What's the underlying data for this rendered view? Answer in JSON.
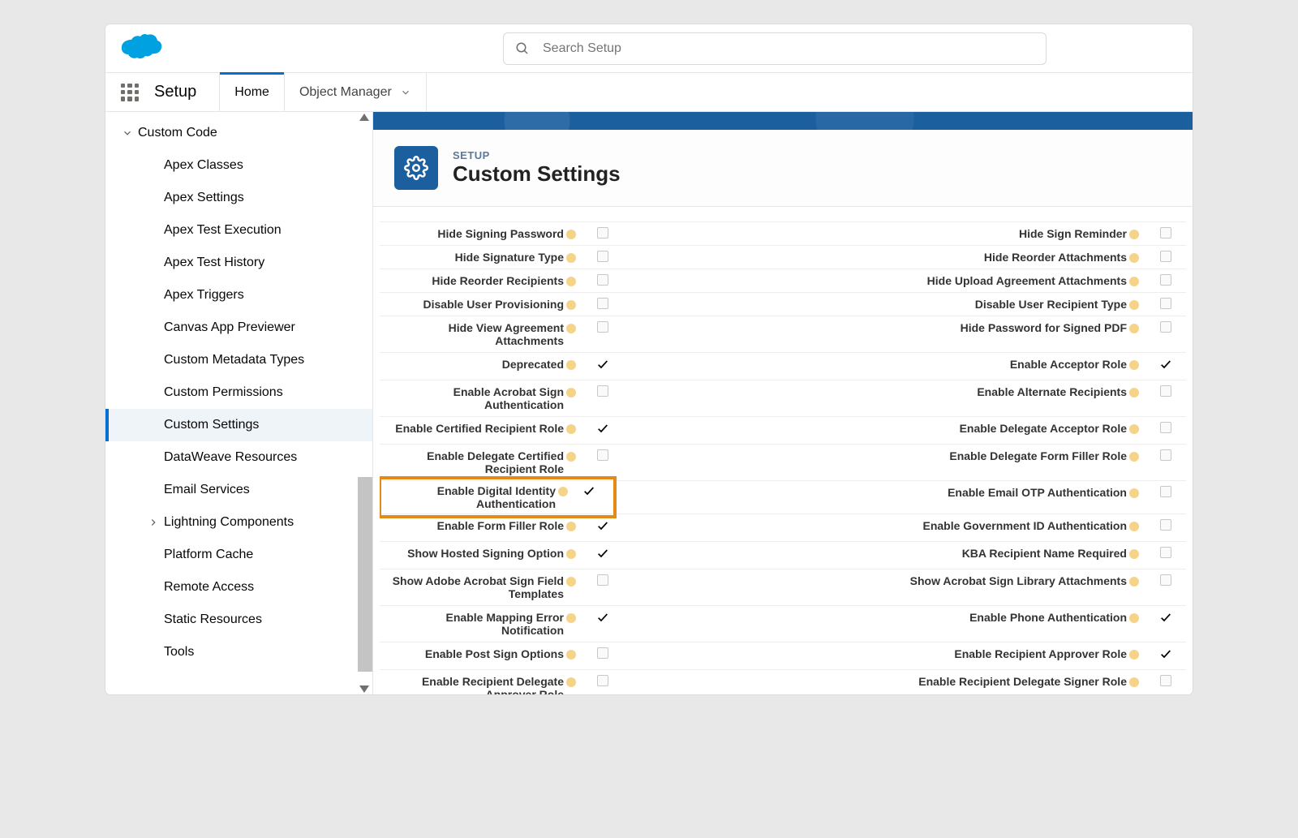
{
  "header": {
    "search_placeholder": "Search Setup"
  },
  "nav": {
    "brand": "Setup",
    "tabs": [
      {
        "label": "Home",
        "active": true
      },
      {
        "label": "Object Manager",
        "active": false,
        "dropdown": true
      }
    ]
  },
  "sidebar": {
    "root": "Custom Code",
    "items": [
      {
        "label": "Apex Classes"
      },
      {
        "label": "Apex Settings"
      },
      {
        "label": "Apex Test Execution"
      },
      {
        "label": "Apex Test History"
      },
      {
        "label": "Apex Triggers"
      },
      {
        "label": "Canvas App Previewer"
      },
      {
        "label": "Custom Metadata Types"
      },
      {
        "label": "Custom Permissions"
      },
      {
        "label": "Custom Settings",
        "selected": true
      },
      {
        "label": "DataWeave Resources"
      },
      {
        "label": "Email Services"
      },
      {
        "label": "Lightning Components",
        "expandable": true
      },
      {
        "label": "Platform Cache"
      },
      {
        "label": "Remote Access"
      },
      {
        "label": "Static Resources"
      },
      {
        "label": "Tools"
      }
    ]
  },
  "page": {
    "eyebrow": "SETUP",
    "title": "Custom Settings"
  },
  "settings_rows": [
    {
      "left_label": "Hide Signing Password",
      "left_checked": false,
      "right_label": "Hide Sign Reminder",
      "right_checked": false
    },
    {
      "left_label": "Hide Signature Type",
      "left_checked": false,
      "right_label": "Hide Reorder Attachments",
      "right_checked": false
    },
    {
      "left_label": "Hide Reorder Recipients",
      "left_checked": false,
      "right_label": "Hide Upload Agreement Attachments",
      "right_checked": false
    },
    {
      "left_label": "Disable User Provisioning",
      "left_checked": false,
      "right_label": "Disable User Recipient Type",
      "right_checked": false
    },
    {
      "left_label": "Hide View Agreement Attachments",
      "left_checked": false,
      "right_label": "Hide Password for Signed PDF",
      "right_checked": false
    },
    {
      "left_label": "Deprecated",
      "left_checked": true,
      "right_label": "Enable Acceptor Role",
      "right_checked": true
    },
    {
      "left_label": "Enable Acrobat Sign Authentication",
      "left_checked": false,
      "right_label": "Enable Alternate Recipients",
      "right_checked": false
    },
    {
      "left_label": "Enable Certified Recipient Role",
      "left_checked": true,
      "right_label": "Enable Delegate Acceptor Role",
      "right_checked": false
    },
    {
      "left_label": "Enable Delegate Certified Recipient Role",
      "left_checked": false,
      "right_label": "Enable Delegate Form Filler Role",
      "right_checked": false
    },
    {
      "left_label": "Enable Digital Identity Authentication",
      "left_checked": true,
      "highlight": true,
      "right_label": "Enable Email OTP Authentication",
      "right_checked": false
    },
    {
      "left_label": "Enable Form Filler Role",
      "left_checked": true,
      "right_label": "Enable Government ID Authentication",
      "right_checked": false
    },
    {
      "left_label": "Show Hosted Signing Option",
      "left_checked": true,
      "right_label": "KBA Recipient Name Required",
      "right_checked": false
    },
    {
      "left_label": "Show Adobe Acrobat Sign Field Templates",
      "left_checked": false,
      "right_label": "Show Acrobat Sign Library Attachments",
      "right_checked": false
    },
    {
      "left_label": "Enable Mapping Error Notification",
      "left_checked": true,
      "right_label": "Enable Phone Authentication",
      "right_checked": true
    },
    {
      "left_label": "Enable Post Sign Options",
      "left_checked": false,
      "right_label": "Enable Recipient Approver Role",
      "right_checked": true
    },
    {
      "left_label": "Enable Recipient Delegate Approver Role",
      "left_checked": false,
      "right_label": "Enable Recipient Delegate Signer Role",
      "right_checked": false
    }
  ]
}
